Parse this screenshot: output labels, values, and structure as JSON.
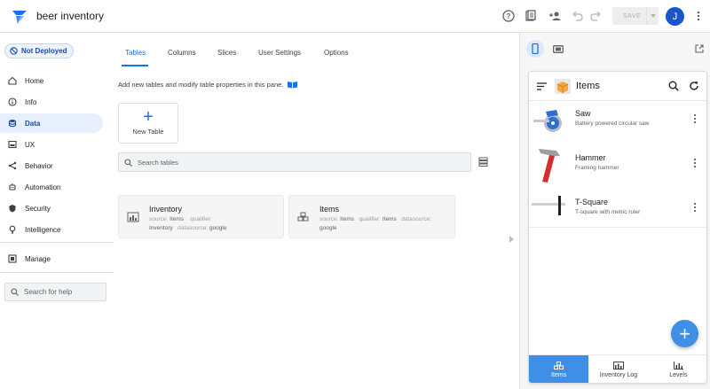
{
  "app": {
    "title": "beer inventory"
  },
  "header": {
    "save_label": "SAVE",
    "avatar_initial": "J"
  },
  "sidebar": {
    "deploy_status": "Not Deployed",
    "items": [
      {
        "label": "Home",
        "icon": "home-icon"
      },
      {
        "label": "Info",
        "icon": "info-icon"
      },
      {
        "label": "Data",
        "icon": "data-icon",
        "active": true
      },
      {
        "label": "UX",
        "icon": "ux-icon"
      },
      {
        "label": "Behavior",
        "icon": "behavior-icon"
      },
      {
        "label": "Automation",
        "icon": "automation-icon"
      },
      {
        "label": "Security",
        "icon": "security-icon"
      },
      {
        "label": "Intelligence",
        "icon": "intelligence-icon"
      }
    ],
    "manage_label": "Manage",
    "help_placeholder": "Search for help"
  },
  "main": {
    "tabs": [
      {
        "label": "Tables",
        "active": true
      },
      {
        "label": "Columns"
      },
      {
        "label": "Slices"
      },
      {
        "label": "User Settings"
      },
      {
        "label": "Options"
      }
    ],
    "help_text": "Add new tables and modify table properties in this pane.",
    "new_table_label": "New Table",
    "search_placeholder": "Search tables",
    "tables": [
      {
        "name": "Inventory",
        "source_label": "source:",
        "source": "Items",
        "qualifier_label": "qualifier:",
        "qualifier": "Inventory",
        "datasource_label": "datasource:",
        "datasource": "google"
      },
      {
        "name": "Items",
        "source_label": "source:",
        "source": "Items",
        "qualifier_label": "qualifier:",
        "qualifier": "Items",
        "datasource_label": "datasource:",
        "datasource": "google"
      }
    ]
  },
  "preview": {
    "view_title": "Items",
    "rows": [
      {
        "title": "Saw",
        "subtitle": "Battery powered circular saw"
      },
      {
        "title": "Hammer",
        "subtitle": "Framing hammer"
      },
      {
        "title": "T-Square",
        "subtitle": "T-square with metric ruler"
      }
    ],
    "fab_label": "+",
    "nav": [
      {
        "label": "Items",
        "active": true
      },
      {
        "label": "Inventory Log"
      },
      {
        "label": "Levels"
      }
    ]
  },
  "colors": {
    "accent": "#1a73e8",
    "avatar": "#1a56c9",
    "fab": "#3f8fe6",
    "active_nav_bg": "#e8effc"
  }
}
